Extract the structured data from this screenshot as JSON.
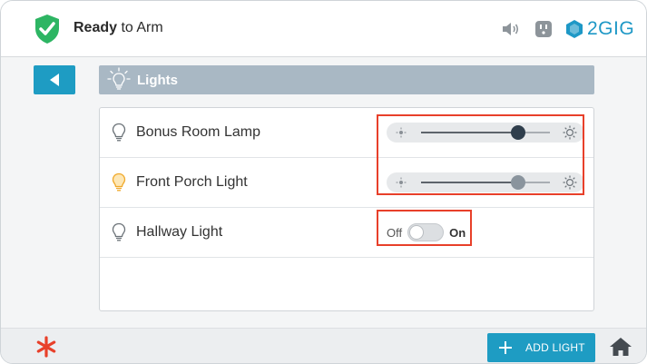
{
  "header": {
    "status_bold": "Ready",
    "status_rest": " to Arm",
    "brand": "2GIG",
    "icons": [
      "shield-check-icon",
      "moon-icon",
      "speaker-icon",
      "outlet-icon",
      "brand-logo-icon"
    ]
  },
  "nav": {
    "back_icon": "back-arrow-icon",
    "title": "Lights",
    "title_icon": "lightbulb-icon"
  },
  "lights": [
    {
      "name": "Bonus Room Lamp",
      "control": "dimmer",
      "level": 0.75,
      "bulb_state": "off",
      "knob_color": "#2f3e4c"
    },
    {
      "name": "Front Porch Light",
      "control": "dimmer",
      "level": 0.75,
      "bulb_state": "on",
      "knob_color": "#8a949d"
    },
    {
      "name": "Hallway Light",
      "control": "switch",
      "state": "Off",
      "off_label": "Off",
      "on_label": "On",
      "bulb_state": "off"
    }
  ],
  "footer": {
    "add_label": "ADD LIGHT",
    "icons": [
      "emergency-asterisk-icon",
      "plus-icon",
      "home-icon"
    ]
  },
  "colors": {
    "accent": "#1e9cc3",
    "highlight": "#e8402a",
    "shield": "#2db563",
    "bulb_on": "#f0a92b",
    "title_bar": "#a9b8c4"
  }
}
